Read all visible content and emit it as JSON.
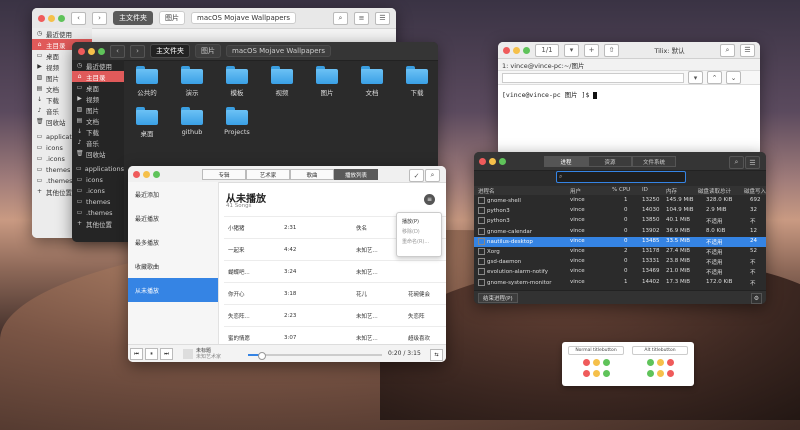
{
  "files_light": {
    "crumbs": [
      "主文件夹",
      "图片",
      "macOS Mojave Wallpapers"
    ],
    "sidebar": [
      "最近使用",
      "主目录",
      "桌面",
      "视频",
      "图片",
      "文档",
      "下载",
      "音乐",
      "回收站",
      "applications",
      "icons",
      ".icons",
      "themes",
      ".themes",
      "其他位置"
    ],
    "active_sidebar": 1
  },
  "files_dark": {
    "crumbs": [
      "主文件夹",
      "图片",
      "macOS Mojave Wallpapers"
    ],
    "sidebar": [
      "最近使用",
      "主目录",
      "桌面",
      "视频",
      "图片",
      "文档",
      "下载",
      "音乐",
      "回收站",
      "applications",
      "icons",
      ".icons",
      "themes",
      ".themes",
      "其他位置"
    ],
    "active_sidebar": 1,
    "folders": [
      "公共的",
      "演示",
      "模板",
      "视频",
      "图片",
      "文档",
      "下载",
      "音乐",
      "桌面",
      "github",
      "Projects"
    ]
  },
  "terminal": {
    "tab_counter": "1/1",
    "title": "Tilix: 默认",
    "tab_label": "1: vince@vince-pc:~/图片",
    "prompt": "[vince@vince-pc 图片 ]$ "
  },
  "music": {
    "tabs": [
      "专辑",
      "艺术家",
      "歌曲",
      "播放列表"
    ],
    "active_tab": 3,
    "sidebar": [
      "最近添加",
      "最近播放",
      "最多播放",
      "收藏歌曲",
      "从未播放"
    ],
    "active_sidebar": 4,
    "title": "从未播放",
    "subtitle": "41 Songs",
    "songs": [
      {
        "title": "小猪猪",
        "duration": "2:31",
        "artist": "佚名"
      },
      {
        "title": "一起来",
        "duration": "4:42",
        "artist": "未知艺..."
      },
      {
        "title": "蝴蝶吧...",
        "duration": "3:24",
        "artist": "未知艺..."
      },
      {
        "title": "你开心",
        "duration": "3:18",
        "artist": "花儿",
        "album": "花碗健会"
      },
      {
        "title": "失恋阵...",
        "duration": "2:23",
        "artist": "未知艺...",
        "album": "失恋阵"
      },
      {
        "title": "蜜的情愿",
        "duration": "3:07",
        "artist": "未知艺...",
        "album": "超级喜欢"
      }
    ],
    "menu": [
      "播放(P)",
      "移除(D)",
      "重命名(R)..."
    ],
    "now_playing": {
      "title": "未标题",
      "artist": "未知艺术家",
      "time": "0:20 / 3:15",
      "progress": 0.1
    }
  },
  "sysmon": {
    "tabs": [
      "进程",
      "资源",
      "文件系统"
    ],
    "active_tab": 0,
    "columns": [
      "进程名",
      "用户",
      "% CPU",
      "ID",
      "内存",
      "磁盘读取总计",
      "磁盘写入"
    ],
    "rows": [
      {
        "name": "gnome-shell",
        "user": "vince",
        "cpu": "1",
        "id": "13250",
        "mem": "145.9 MiB",
        "read": "328.0 KiB",
        "write": "692"
      },
      {
        "name": "python3",
        "user": "vince",
        "cpu": "0",
        "id": "14030",
        "mem": "104.9 MiB",
        "read": "2.9 MiB",
        "write": "32"
      },
      {
        "name": "python3",
        "user": "vince",
        "cpu": "0",
        "id": "13850",
        "mem": "40.1 MiB",
        "read": "不适用",
        "write": "不"
      },
      {
        "name": "gnome-calendar",
        "user": "vince",
        "cpu": "0",
        "id": "13902",
        "mem": "36.9 MiB",
        "read": "8.0 KiB",
        "write": "12"
      },
      {
        "name": "nautilus-desktop",
        "user": "vince",
        "cpu": "0",
        "id": "13485",
        "mem": "33.5 MiB",
        "read": "不适用",
        "write": "24"
      },
      {
        "name": "Xorg",
        "user": "vince",
        "cpu": "2",
        "id": "13178",
        "mem": "27.4 MiB",
        "read": "不适用",
        "write": "52"
      },
      {
        "name": "gsd-daemon",
        "user": "vince",
        "cpu": "0",
        "id": "13331",
        "mem": "23.8 MiB",
        "read": "不适用",
        "write": "不"
      },
      {
        "name": "evolution-alarm-notify",
        "user": "vince",
        "cpu": "0",
        "id": "13469",
        "mem": "21.0 MiB",
        "read": "不适用",
        "write": "不"
      },
      {
        "name": "gnome-system-monitor",
        "user": "vince",
        "cpu": "1",
        "id": "14402",
        "mem": "17.3 MiB",
        "read": "172.0 KiB",
        "write": "不"
      }
    ],
    "selected_row": 4,
    "end_button": "结束进程(P)"
  },
  "legend": {
    "normal_title": "Normal titlebutton",
    "alt_title": "Alt titlebutton"
  }
}
